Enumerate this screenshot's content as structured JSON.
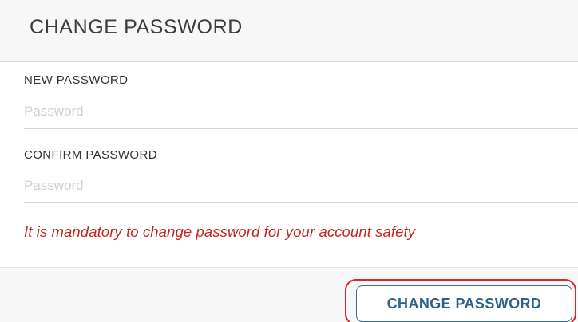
{
  "modal": {
    "title": "CHANGE PASSWORD"
  },
  "fields": {
    "new_password": {
      "label": "NEW PASSWORD",
      "placeholder": "Password",
      "value": ""
    },
    "confirm_password": {
      "label": "CONFIRM PASSWORD",
      "placeholder": "Password",
      "value": ""
    }
  },
  "warning": {
    "text": "It is mandatory to change password for your account safety",
    "color": "#c4251e"
  },
  "footer": {
    "submit_label": "CHANGE PASSWORD"
  },
  "colors": {
    "accent": "#2b6488",
    "highlight": "#d42a2a"
  }
}
